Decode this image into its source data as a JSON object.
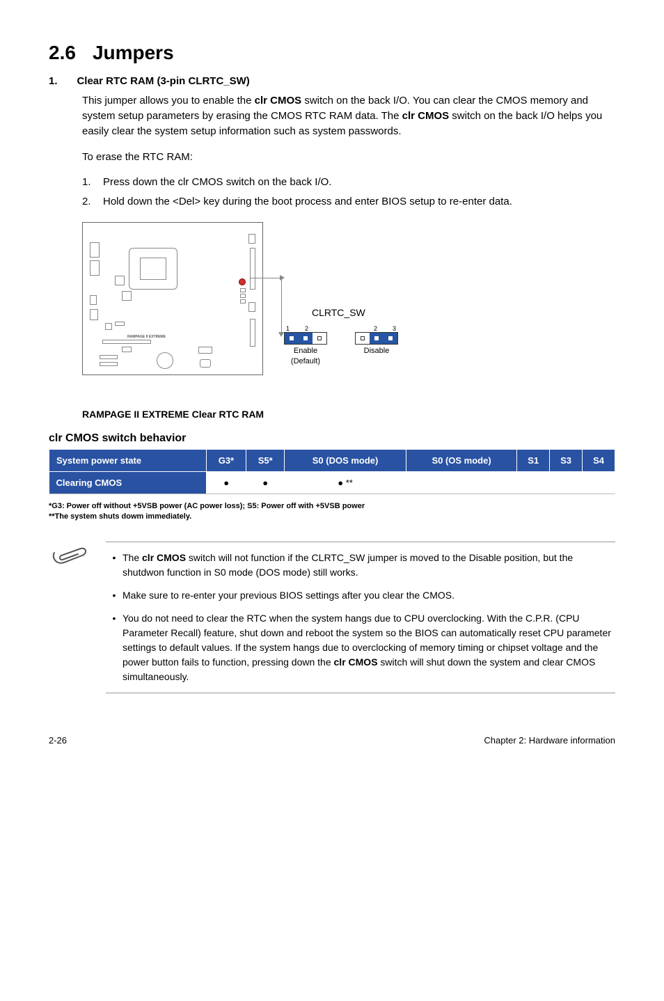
{
  "section": {
    "number": "2.6",
    "title": "Jumpers"
  },
  "item": {
    "number": "1.",
    "title": "Clear RTC RAM (3-pin CLRTC_SW)"
  },
  "para1_a": "This jumper allows you to enable the ",
  "para1_b": "clr CMOS",
  "para1_c": " switch on the back I/O. You can clear the CMOS memory and system setup parameters by erasing the CMOS RTC RAM data. The ",
  "para1_d": "clr CMOS",
  "para1_e": " switch on the back I/O helps you easily clear the system setup information such as system passwords.",
  "erase_intro": "To erase the RTC RAM:",
  "steps": {
    "s1n": "1.",
    "s1": "Press down the clr CMOS switch on the back I/O.",
    "s2n": "2.",
    "s2": "Hold down the <Del> key during the boot process and enter BIOS setup to re-enter data."
  },
  "diagram": {
    "jumper_label": "CLRTC_SW",
    "jA_nums_left": "1",
    "jA_nums_right": "2",
    "jA_text1": "Enable",
    "jA_text2": "(Default)",
    "jB_nums_left": "2",
    "jB_nums_right": "3",
    "jB_text1": "Disable",
    "caption": "RAMPAGE II EXTREME Clear RTC RAM"
  },
  "behavior_title": "clr CMOS switch behavior",
  "table": {
    "h1": "System power state",
    "h2": "G3*",
    "h3": "S5*",
    "h4": "S0 (DOS mode)",
    "h5": "S0 (OS mode)",
    "h6": "S1",
    "h7": "S3",
    "h8": "S4",
    "row_label": "Clearing CMOS",
    "c1": "●",
    "c2": "●",
    "c3": "● **",
    "c4": "",
    "c5": "",
    "c6": "",
    "c7": ""
  },
  "tablenote1": "*G3: Power off without +5VSB power (AC power loss); S5: Power off with +5VSB power",
  "tablenote2": "**The system shuts dowm immediately.",
  "notes": {
    "n1a": "The ",
    "n1b": "clr CMOS",
    "n1c": " switch will not function if the CLRTC_SW jumper is moved to the Disable position, but the shutdwon function in S0 mode (DOS mode) still works.",
    "n2": "Make sure to re-enter your previous BIOS settings after you clear the CMOS.",
    "n3a": "You do not need to clear the RTC when the system hangs due to CPU overclocking. With the C.P.R. (CPU Parameter Recall) feature, shut down and reboot the system so the BIOS can automatically reset CPU parameter settings to default values. If the system hangs due to overclocking of memory timing or chipset voltage and the power button fails to function, pressing down the ",
    "n3b": "clr CMOS",
    "n3c": " switch will shut down the system and clear CMOS simultaneously."
  },
  "footer": {
    "left": "2-26",
    "right": "Chapter 2: Hardware information"
  }
}
